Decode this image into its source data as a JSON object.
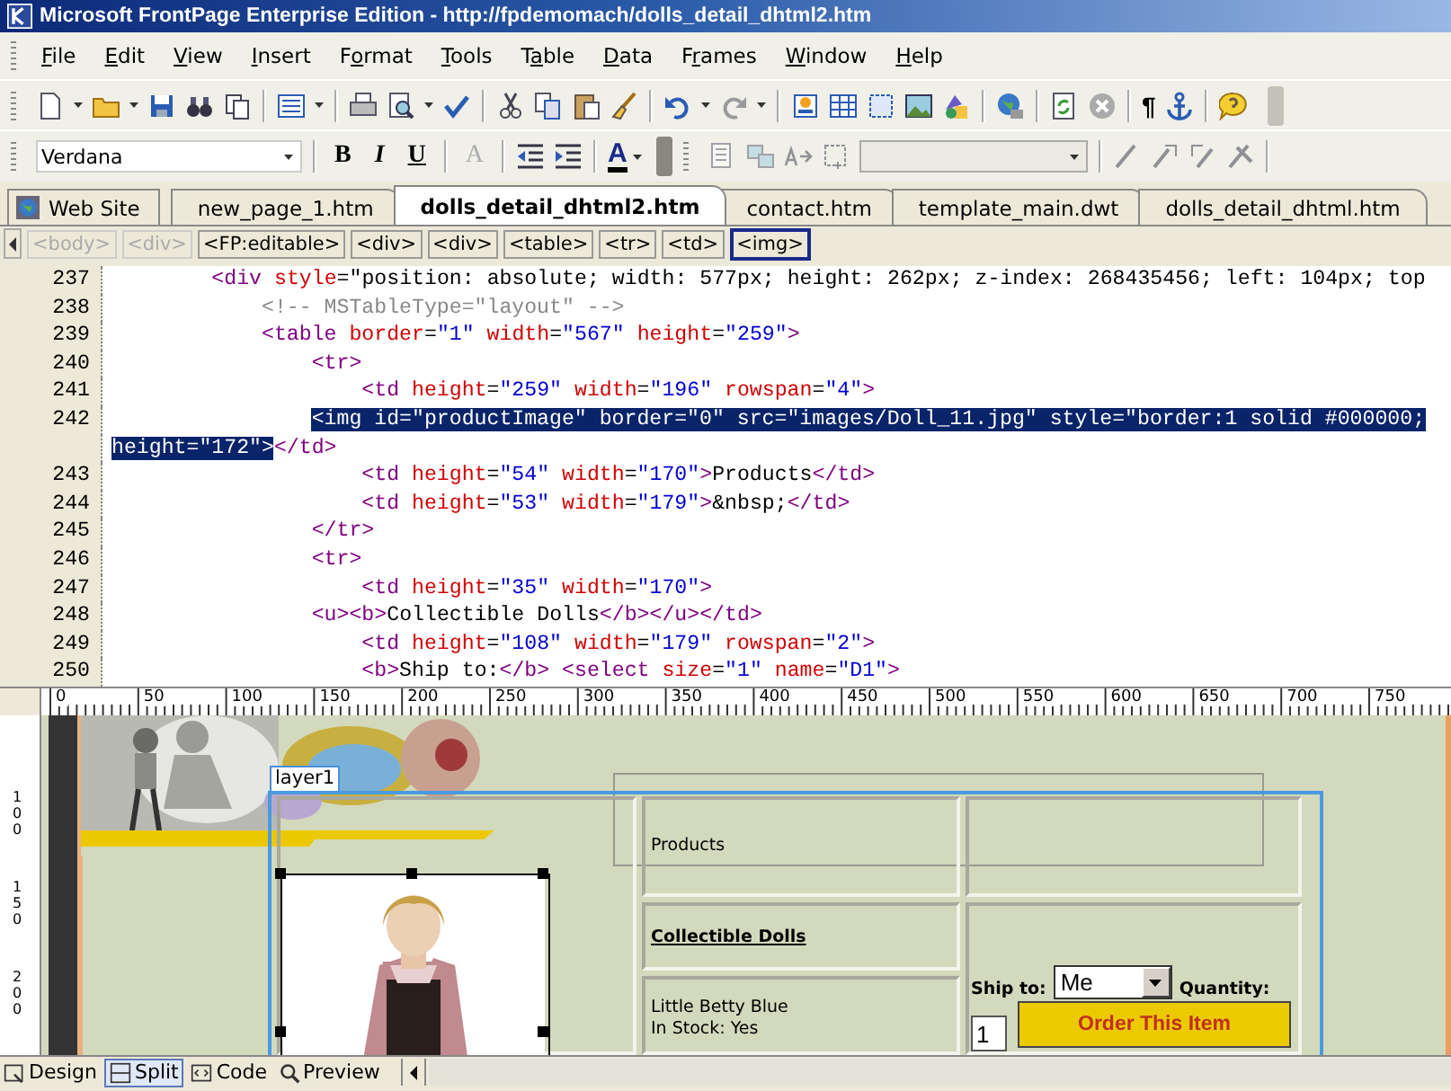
{
  "window": {
    "title": "Microsoft FrontPage Enterprise Edition - http://fpdemomach/dolls_detail_dhtml2.htm"
  },
  "menu": [
    {
      "key": "F",
      "post": "ile"
    },
    {
      "key": "E",
      "post": "dit"
    },
    {
      "key": "V",
      "post": "iew"
    },
    {
      "key": "I",
      "post": "nsert"
    },
    {
      "pre": "F",
      "key": "o",
      "post": "rmat"
    },
    {
      "key": "T",
      "post": "ools"
    },
    {
      "pre": "T",
      "key": "a",
      "post": "ble"
    },
    {
      "key": "D",
      "post": "ata"
    },
    {
      "pre": "F",
      "key": "r",
      "post": "ames"
    },
    {
      "key": "W",
      "post": "indow"
    },
    {
      "key": "H",
      "post": "elp"
    }
  ],
  "toolbar": {
    "pilcrow": "¶"
  },
  "formatting": {
    "font": "Verdana",
    "buttons": [
      {
        "label": "B",
        "kind": "bold",
        "disabled": false
      },
      {
        "label": "I",
        "kind": "italic",
        "disabled": false
      },
      {
        "label": "U",
        "kind": "underline",
        "disabled": false
      },
      {
        "label": "A",
        "kind": "grow",
        "disabled": true
      }
    ],
    "font_color": "A"
  },
  "document_tabs": [
    {
      "label": "Web Site",
      "kind": "site",
      "selected": false
    },
    {
      "label": "new_page_1.htm",
      "kind": "file",
      "selected": false
    },
    {
      "label": "dolls_detail_dhtml2.htm",
      "kind": "file",
      "selected": true
    },
    {
      "label": "contact.htm",
      "kind": "file",
      "selected": false
    },
    {
      "label": "template_main.dwt",
      "kind": "file",
      "selected": false
    },
    {
      "label": "dolls_detail_dhtml.htm",
      "kind": "file",
      "selected": false
    }
  ],
  "tag_selector": [
    {
      "label": "<body>",
      "disabled": true,
      "selected": false
    },
    {
      "label": "<div>",
      "disabled": true,
      "selected": false
    },
    {
      "label": "<FP:editable>",
      "disabled": false,
      "selected": false
    },
    {
      "label": "<div>",
      "disabled": false,
      "selected": false
    },
    {
      "label": "<div>",
      "disabled": false,
      "selected": false
    },
    {
      "label": "<table>",
      "disabled": false,
      "selected": false
    },
    {
      "label": "<tr>",
      "disabled": false,
      "selected": false
    },
    {
      "label": "<td>",
      "disabled": false,
      "selected": false
    },
    {
      "label": "<img>",
      "disabled": false,
      "selected": true
    }
  ],
  "code": {
    "lines": [
      {
        "number": "237",
        "segments": [
          {
            "text": "        <div style=\"position: absolute; width: 577px; height: 262px; z-index: 268435456; left: 104px; top",
            "selected": false
          }
        ]
      },
      {
        "number": "238",
        "segments": [
          {
            "text": "            <!-- MSTableType=\"layout\" -->",
            "selected": false
          }
        ]
      },
      {
        "number": "239",
        "segments": [
          {
            "text": "            <table border=\"1\" width=\"567\" height=\"259\">",
            "selected": false
          }
        ]
      },
      {
        "number": "240",
        "segments": [
          {
            "text": "                <tr>",
            "selected": false
          }
        ]
      },
      {
        "number": "241",
        "segments": [
          {
            "text": "                    <td height=\"259\" width=\"196\" rowspan=\"4\">",
            "selected": false
          }
        ]
      },
      {
        "number": "242",
        "segments": [
          {
            "text": "                <img id=\"productImage\" border=\"0\" src=\"images/Doll_11.jpg\" style=\"border:1 solid #000000;",
            "selected": true
          }
        ]
      },
      {
        "segments": [
          {
            "text": "height=\"172\">",
            "selected": true
          },
          {
            "text": "</td>",
            "selected": false
          }
        ]
      },
      {
        "number": "243",
        "segments": [
          {
            "text": "                    <td height=\"54\" width=\"170\">Products</td>",
            "selected": false
          }
        ]
      },
      {
        "number": "244",
        "segments": [
          {
            "text": "                    <td height=\"53\" width=\"179\">&nbsp;</td>",
            "selected": false
          }
        ]
      },
      {
        "number": "245",
        "segments": [
          {
            "text": "                </tr>",
            "selected": false
          }
        ]
      },
      {
        "number": "246",
        "segments": [
          {
            "text": "                <tr>",
            "selected": false
          }
        ]
      },
      {
        "number": "247",
        "segments": [
          {
            "text": "                    <td height=\"35\" width=\"170\">",
            "selected": false
          }
        ]
      },
      {
        "number": "248",
        "segments": [
          {
            "text": "                <u><b>Collectible Dolls</b></u></td>",
            "selected": false
          }
        ]
      },
      {
        "number": "249",
        "segments": [
          {
            "text": "                    <td height=\"108\" width=\"179\" rowspan=\"2\">",
            "selected": false
          }
        ]
      },
      {
        "number": "250",
        "segments": [
          {
            "text": "                    <b>Ship to:</b> <select size=\"1\" name=\"D1\">",
            "selected": false
          }
        ]
      }
    ]
  },
  "ruler": {
    "horizontal": [
      "0",
      "50",
      "100",
      "150",
      "200",
      "250",
      "300",
      "350",
      "400",
      "450",
      "500",
      "550",
      "600",
      "650",
      "700",
      "750"
    ],
    "vertical": [
      "100",
      "150",
      "200"
    ]
  },
  "design": {
    "layer_label": "layer1",
    "products": "Products",
    "category": "Collectible Dolls",
    "details": [
      "Little Betty Blue",
      "In Stock: Yes"
    ],
    "ship_to_label": "Ship to:",
    "ship_to_value": "Me",
    "quantity_label": "Quantity:",
    "quantity_value": "1",
    "order_button": "Order This Item"
  },
  "view_tabs": [
    {
      "label": "Design",
      "kind": "design",
      "selected": false
    },
    {
      "label": "Split",
      "kind": "split",
      "selected": true
    },
    {
      "label": "Code",
      "kind": "code",
      "selected": false
    },
    {
      "label": "Preview",
      "kind": "preview",
      "selected": false
    }
  ]
}
